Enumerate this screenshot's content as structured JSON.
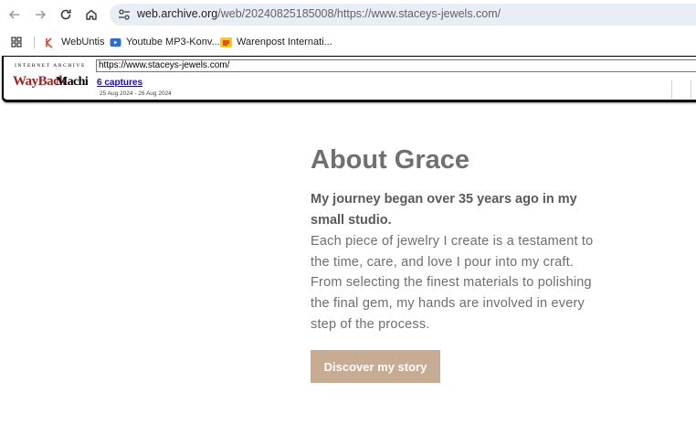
{
  "browser": {
    "url_host": "web.archive.org",
    "url_path": "/web/20240825185008/https://www.staceys-jewels.com/"
  },
  "bookmarks": [
    {
      "label": "WebUntis",
      "icon": "webuntis-icon"
    },
    {
      "label": "Youtube MP3-Konv...",
      "icon": "youtube-icon"
    },
    {
      "label": "Warenpost Internati...",
      "icon": "dhl-icon"
    }
  ],
  "wayback": {
    "brand_top": "INTERNET ARCHIVE",
    "brand_logo": "WaybackMachine",
    "url_value": "https://www.staceys-jewels.com/",
    "captures": "6 captures",
    "date_range": "25 Aug 2024 - 26 Aug 2024"
  },
  "page": {
    "title": "About Grace",
    "lead": "My journey began over 35 years ago in my small studio.",
    "body": "Each piece of jewelry I create is a testament to the time, care, and love I pour into my craft. From selecting the finest materials to polishing the final gem, my hands are involved in every step of the process.",
    "cta_label": "Discover my story"
  },
  "colors": {
    "cta_bg": "#c8ab93",
    "title": "#707070",
    "omnibox_bg": "#e9eef6"
  }
}
